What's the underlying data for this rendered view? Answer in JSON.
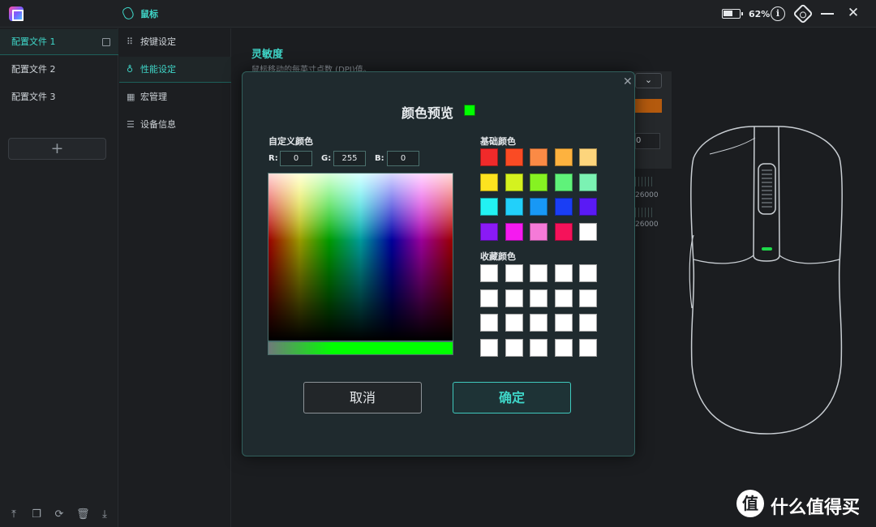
{
  "titlebar": {
    "tab_label": "鼠标",
    "battery_pct": "62%",
    "info_icon": "i",
    "close_icon": "✕"
  },
  "profiles": {
    "items": [
      "配置文件 1",
      "配置文件 2",
      "配置文件 3"
    ],
    "add_label": "+"
  },
  "nav": {
    "items": [
      {
        "label": "按键设定",
        "icon": "grid-dots-icon"
      },
      {
        "label": "性能设定",
        "icon": "performance-icon"
      },
      {
        "label": "宏管理",
        "icon": "macro-icon"
      },
      {
        "label": "设备信息",
        "icon": "list-icon"
      }
    ]
  },
  "sensitivity": {
    "title": "灵敏度",
    "desc": "鼠标移动的每英寸点数 (DPI)值。"
  },
  "background": {
    "dropdown_arrow": "⌄",
    "box_value": "0",
    "tick1": "26000",
    "tick2": "26000"
  },
  "dialog": {
    "title": "颜色预览",
    "preview_color": "#00ff00",
    "custom_label": "自定义颜色",
    "r_label": "R:",
    "g_label": "G:",
    "b_label": "B:",
    "r_value": "0",
    "g_value": "255",
    "b_value": "0",
    "basic_label": "基础颜色",
    "basic_colors": [
      "#f02a2a",
      "#fa4b24",
      "#fb8a45",
      "#fdb23f",
      "#fdd57c",
      "#fde31f",
      "#d4f21f",
      "#86f222",
      "#5ff27a",
      "#7bf2b3",
      "#22f2f2",
      "#22d0fa",
      "#1898f5",
      "#1a3ef5",
      "#5a1af5",
      "#8a1af5",
      "#f51af0",
      "#f57ad8",
      "#f5125a",
      "#ffffff"
    ],
    "favorites_label": "收藏颜色",
    "favorite_colors": [
      "#ffffff",
      "#ffffff",
      "#ffffff",
      "#ffffff",
      "#ffffff",
      "#ffffff",
      "#ffffff",
      "#ffffff",
      "#ffffff",
      "#ffffff",
      "#ffffff",
      "#ffffff",
      "#ffffff",
      "#ffffff",
      "#ffffff",
      "#ffffff",
      "#ffffff",
      "#ffffff",
      "#ffffff",
      "#ffffff"
    ],
    "cancel_label": "取消",
    "ok_label": "确定"
  },
  "watermark": {
    "logo": "值",
    "text": "什么值得买"
  },
  "accent_color": "#3fd6c8"
}
